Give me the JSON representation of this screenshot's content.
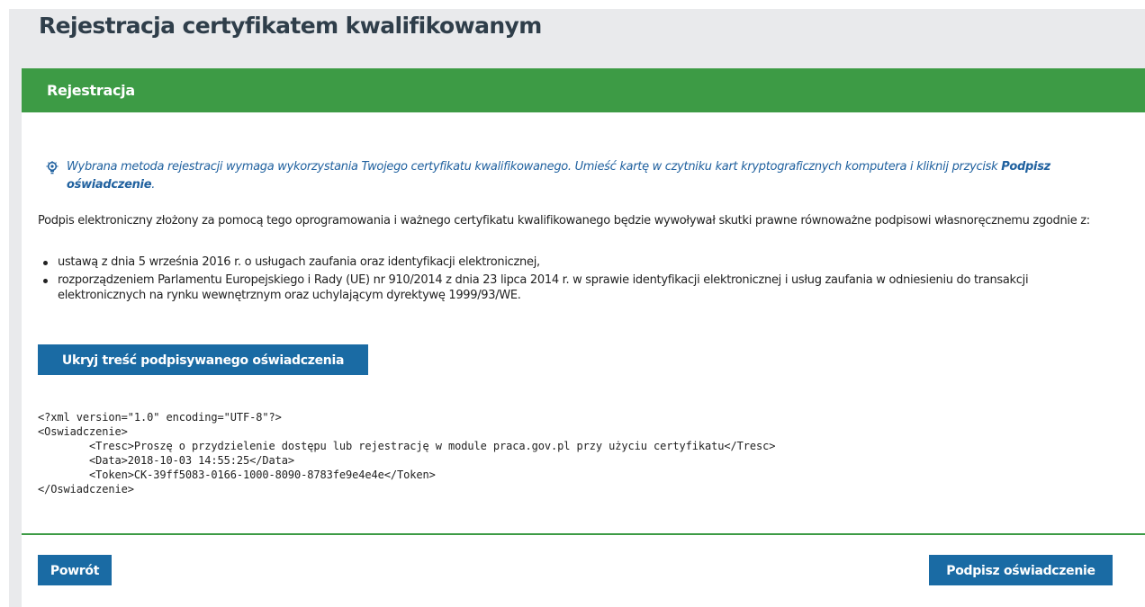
{
  "page": {
    "title": "Rejestracja certyfikatem kwalifikowanym"
  },
  "panel": {
    "header": "Rejestracja",
    "info_icon": "lightbulb-icon",
    "info_text": "Wybrana metoda rejestracji wymaga wykorzystania Twojego certyfikatu kwalifikowanego. Umieść kartę w czytniku kart kryptograficznych komputera i kliknij przycisk ",
    "info_bold": "Podpisz oświadczenie",
    "info_end": ".",
    "paragraph": "Podpis elektroniczny złożony za pomocą tego oprogramowania i ważnego certyfikatu kwalifikowanego będzie wywoływał skutki prawne równoważne podpisowi własnoręcznemu zgodnie z:",
    "list": [
      "ustawą z dnia 5 września 2016 r. o usługach zaufania oraz identyfikacji elektronicznej,",
      "rozporządzeniem Parlamentu Europejskiego i Rady (UE) nr 910/2014 z dnia 23 lipca 2014 r. w sprawie identyfikacji elektronicznej i usług zaufania w odniesieniu do transakcji elektronicznych na rynku wewnętrznym oraz uchylającym dyrektywę 1999/93/WE."
    ],
    "toggle_button": "Ukryj treść podpisywanego oświadczenia",
    "xml_lines": [
      "<?xml version=\"1.0\" encoding=\"UTF-8\"?>",
      "<Oswiadczenie>",
      "        <Tresc>Proszę o przydzielenie dostępu lub rejestrację w module praca.gov.pl przy użyciu certyfikatu</Tresc>",
      "        <Data>2018-10-03 14:55:25</Data>",
      "        <Token>CK-39ff5083-0166-1000-8090-8783fe9e4e4e</Token>",
      "</Oswiadczenie>"
    ]
  },
  "footer": {
    "back_button": "Powrót",
    "sign_button": "Podpisz oświadczenie"
  },
  "colors": {
    "header_green": "#3d9b45",
    "button_blue": "#1a6ba4",
    "info_blue": "#20619f",
    "background_gray": "#e9eaec"
  }
}
